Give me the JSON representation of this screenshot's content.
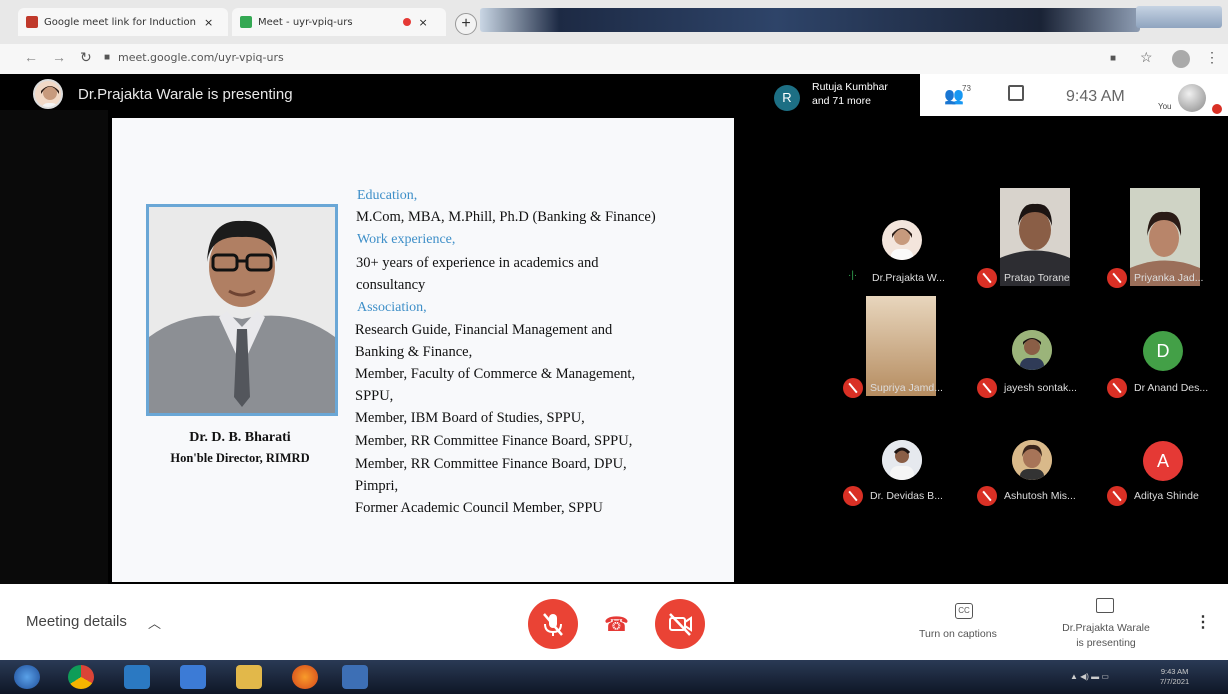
{
  "browser": {
    "tabs": [
      {
        "title": "Google meet link for Induction",
        "close": "×"
      },
      {
        "title": "Meet - uyr-vpiq-urs",
        "close": "×"
      }
    ],
    "new_tab": "+",
    "url": "meet.google.com/uyr-vpiq-urs"
  },
  "meet": {
    "presenting_label": "Dr.Prajakta Warale is presenting",
    "participants_summary": {
      "avatar_letter": "R",
      "line1": "Rutuja Kumbhar",
      "line2": "and 71 more"
    },
    "participant_count": "73",
    "clock": "9:43 AM",
    "you_label": "You"
  },
  "slide": {
    "person_name": "Dr. D. B. Bharati",
    "person_title": "Hon'ble Director, RIMRD",
    "education_heading": "Education,",
    "education": "M.Com, MBA, M.Phill, Ph.D (Banking & Finance)",
    "work_heading": "Work experience,",
    "work_lines": [
      "30+ years of experience in academics and",
      "consultancy"
    ],
    "association_heading": "Association,",
    "association_lines": [
      "Research Guide, Financial Management and",
      "Banking & Finance,",
      "Member, Faculty of Commerce & Management,",
      "SPPU,",
      "Member, IBM Board of Studies, SPPU,",
      "Member, RR Committee Finance Board, SPPU,",
      "Member, RR Committee Finance Board, DPU,",
      "Pimpri,",
      "Former Academic Council Member, SPPU"
    ]
  },
  "participants": [
    {
      "name": "Dr.Prajakta W...",
      "muted": false
    },
    {
      "name": "Pratap Torane",
      "muted": true
    },
    {
      "name": "Priyanka Jad...",
      "muted": true
    },
    {
      "name": "Supriya Jamd...",
      "muted": true
    },
    {
      "name": "jayesh sontak...",
      "muted": true
    },
    {
      "name": "Dr Anand Des...",
      "muted": true,
      "letter": "D",
      "color": "#43a047"
    },
    {
      "name": "Dr. Devidas B...",
      "muted": true
    },
    {
      "name": "Ashutosh Mis...",
      "muted": true
    },
    {
      "name": "Aditya Shinde",
      "muted": true,
      "letter": "A",
      "color": "#e53935"
    }
  ],
  "bottom_bar": {
    "meeting_details": "Meeting details",
    "captions_icon": "CC",
    "captions": "Turn on captions",
    "presenting_line1": "Dr.Prajakta Warale",
    "presenting_line2": "is presenting",
    "more": "⋮"
  },
  "taskbar": {
    "time": "9:43 AM",
    "date": "7/7/2021"
  },
  "colors": {
    "danger": "#ea4335",
    "slide_heading": "#3e8fc8",
    "meet_background": "#000000"
  }
}
